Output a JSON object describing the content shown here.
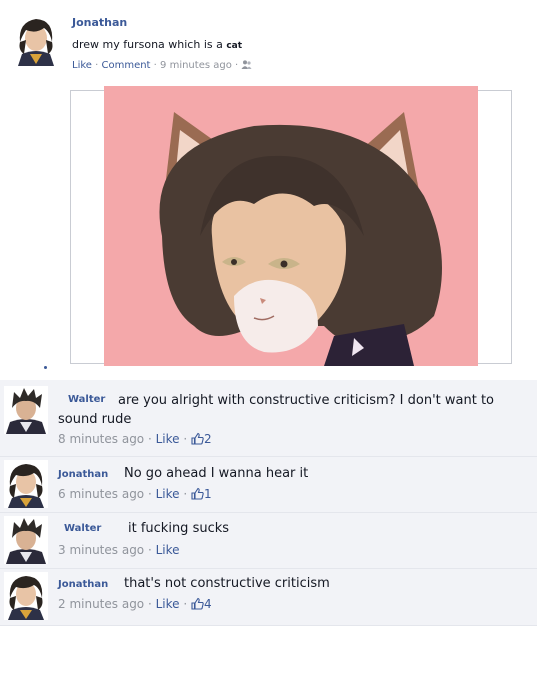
{
  "post": {
    "author": "Jonathan",
    "text_main": "drew my fursona which is a ",
    "text_small": "cat",
    "like": "Like",
    "comment": "Comment",
    "time": "9 minutes ago",
    "sep": " · ",
    "privacy_icon": "friends-icon"
  },
  "comments": [
    {
      "author": "Walter",
      "text": "are you alright with constructive criticism? I don't want to sound rude",
      "time": "8 minutes ago",
      "like": "Like",
      "likes": "2"
    },
    {
      "author": "Jonathan",
      "text": "No go ahead I wanna hear it",
      "time": "6 minutes ago",
      "like": "Like",
      "likes": "1"
    },
    {
      "author": "Walter",
      "text": "it fucking sucks",
      "time": "3 minutes ago",
      "like": "Like",
      "likes": ""
    },
    {
      "author": "Jonathan",
      "text": "that's not constructive criticism",
      "time": "2 minutes ago",
      "like": "Like",
      "likes": "4"
    }
  ],
  "colors": {
    "link": "#3b5998",
    "meta": "#90949c",
    "comment_bg": "#f2f3f7",
    "photo_bg": "#f4a8aa"
  }
}
